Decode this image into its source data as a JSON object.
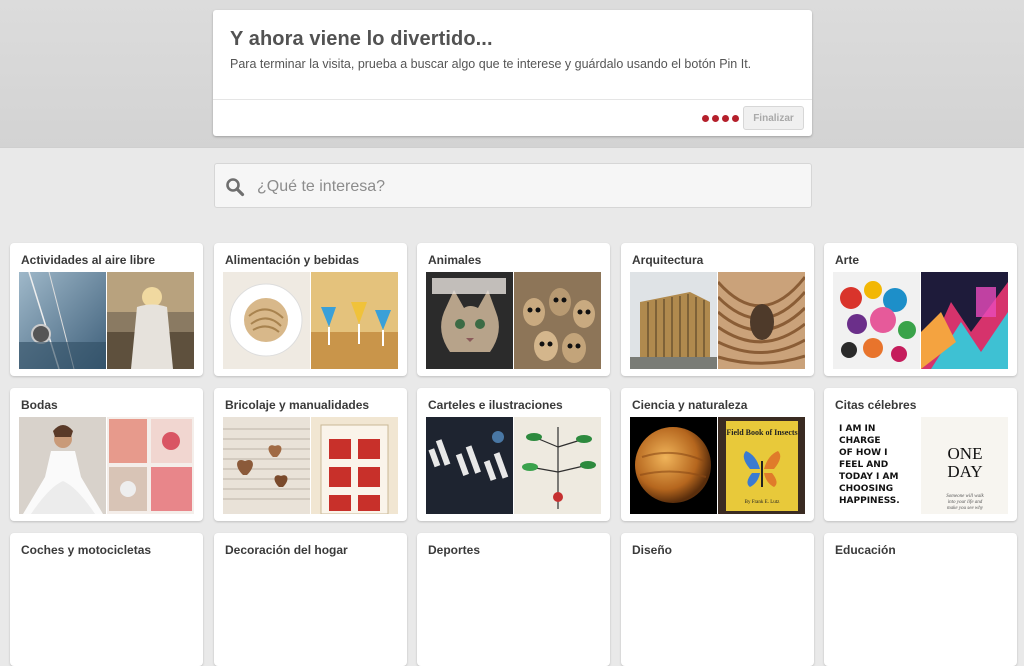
{
  "tour": {
    "title": "Y ahora viene lo divertido...",
    "text": "Para terminar la visita, prueba a buscar algo que te interese y guárdalo usando el botón Pin It.",
    "finish_label": "Finalizar",
    "progress_steps": 4
  },
  "search": {
    "placeholder": "¿Qué te interesa?"
  },
  "categories": [
    {
      "label": "Actividades al aire libre"
    },
    {
      "label": "Alimentación y bebidas"
    },
    {
      "label": "Animales"
    },
    {
      "label": "Arquitectura"
    },
    {
      "label": "Arte"
    },
    {
      "label": "Bodas"
    },
    {
      "label": "Bricolaje y manualidades"
    },
    {
      "label": "Carteles e ilustraciones"
    },
    {
      "label": "Ciencia y naturaleza"
    },
    {
      "label": "Citas célebres"
    },
    {
      "label": "Coches y motocicletas"
    },
    {
      "label": "Decoración del hogar"
    },
    {
      "label": "Deportes"
    },
    {
      "label": "Diseño"
    },
    {
      "label": "Educación"
    }
  ],
  "thumb_text": {
    "book_title": "Field Book of Insects",
    "book_author": "By Frank E. Lutz",
    "quote_left": [
      "I AM IN",
      "CHARGE",
      "OF HOW I",
      "FEEL AND",
      "TODAY I AM",
      "CHOOSING",
      "HAPPINESS."
    ],
    "quote_right": [
      "ONE",
      "DAY"
    ],
    "quote_small": [
      "Someone will walk",
      "into your life and",
      "make you see why"
    ]
  },
  "colors": {
    "accent_red": "#b5202c",
    "background": "#e9e9e9"
  }
}
